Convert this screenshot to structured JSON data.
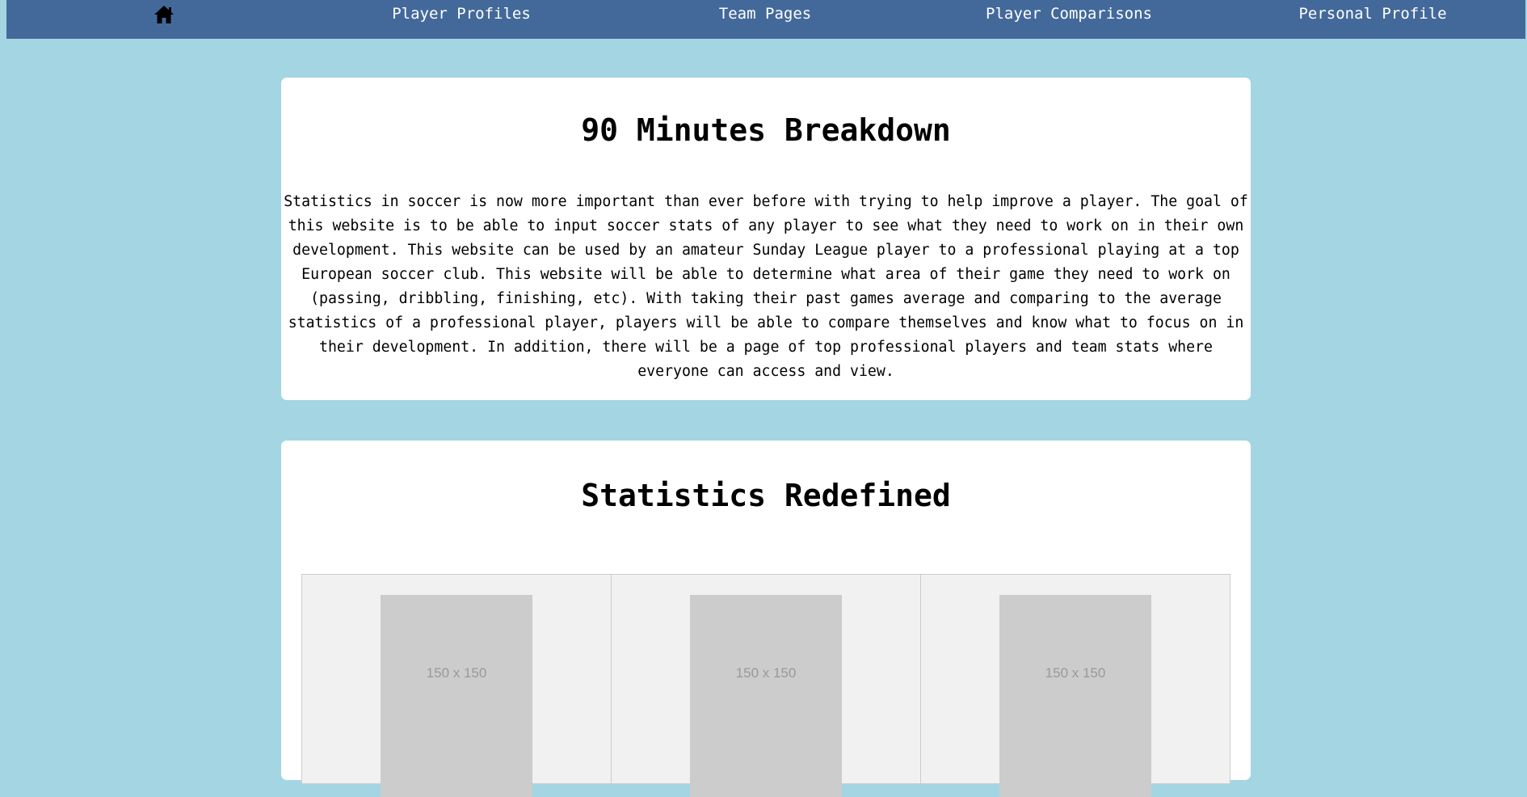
{
  "nav": {
    "home_icon": "home-icon",
    "links": [
      "Player Profiles",
      "Team Pages",
      "Player Comparisons",
      "Personal Profile"
    ]
  },
  "intro": {
    "title": "90 Minutes Breakdown",
    "lines": [
      "Statistics in soccer is now more important than ever before with trying to help improve a player. The goal of",
      "this website is to be able to input soccer stats of any player to see what they need to work on in their own",
      "development. This website can be used by an amateur Sunday League player to a professional playing at a top",
      "European soccer club. This website will be able to determine what area of their game they need to work on",
      "(passing, dribbling, finishing, etc). With taking their past games average and comparing to the average",
      "statistics of a professional player, players will be able to compare themselves and know what to focus on in",
      "their development. In addition, there will be a page of top professional players and team stats where",
      "everyone can access and view."
    ]
  },
  "stats": {
    "title": "Statistics Redefined",
    "placeholders": [
      "150 x 150",
      "150 x 150",
      "150 x 150"
    ]
  },
  "colors": {
    "background": "#a3d5e3",
    "navbar": "#43699a",
    "card": "#ffffff",
    "placeholder": "#cccccc"
  }
}
